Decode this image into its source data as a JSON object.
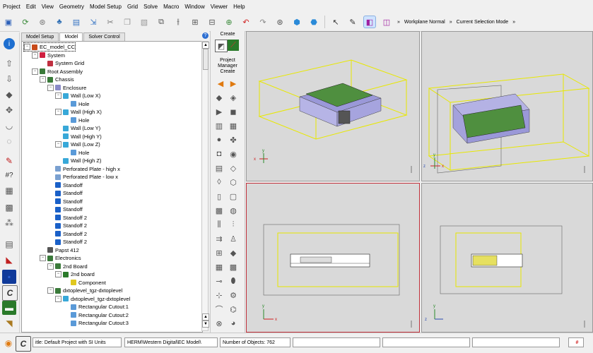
{
  "menu": [
    "Project",
    "Edit",
    "View",
    "Geometry",
    "Model Setup",
    "Grid",
    "Solve",
    "Macro",
    "Window",
    "Viewer",
    "Help"
  ],
  "toolbar": {
    "workplane_label": "Workplane Normal",
    "selection_mode_label": "Current Selection Mode",
    "more_glyph": "»"
  },
  "tabs": [
    "Model Setup",
    "Model",
    "Solver Control"
  ],
  "active_tab": "Model",
  "palette": {
    "title": "Create",
    "manager_label": "Project Manager Create"
  },
  "tree": [
    {
      "label": "EC_model_CC",
      "depth": 0,
      "exp": "-",
      "icon": "root-icon",
      "selected": true
    },
    {
      "label": "System",
      "depth": 1,
      "exp": "-",
      "icon": "system-icon"
    },
    {
      "label": "System Grid",
      "depth": 2,
      "exp": "",
      "icon": "grid-icon"
    },
    {
      "label": "Root Assembly",
      "depth": 1,
      "exp": "-",
      "icon": "assembly-icon"
    },
    {
      "label": "Chassis",
      "depth": 2,
      "exp": "-",
      "icon": "assembly-icon"
    },
    {
      "label": "Enclosure",
      "depth": 3,
      "exp": "-",
      "icon": "enclosure-icon"
    },
    {
      "label": "Wall (Low X)",
      "depth": 4,
      "exp": "-",
      "icon": "wall-icon"
    },
    {
      "label": "Hole",
      "depth": 5,
      "exp": "",
      "icon": "hole-icon"
    },
    {
      "label": "Wall (High X)",
      "depth": 4,
      "exp": "-",
      "icon": "wall-icon"
    },
    {
      "label": "Hole",
      "depth": 5,
      "exp": "",
      "icon": "hole-icon"
    },
    {
      "label": "Wall (Low Y)",
      "depth": 4,
      "exp": "",
      "icon": "wall-icon"
    },
    {
      "label": "Wall (High Y)",
      "depth": 4,
      "exp": "",
      "icon": "wall-icon"
    },
    {
      "label": "Wall (Low Z)",
      "depth": 4,
      "exp": "-",
      "icon": "wall-icon"
    },
    {
      "label": "Hole",
      "depth": 5,
      "exp": "",
      "icon": "hole-icon"
    },
    {
      "label": "Wall (High Z)",
      "depth": 4,
      "exp": "",
      "icon": "wall-icon"
    },
    {
      "label": "Perforated Plate - high x",
      "depth": 3,
      "exp": "",
      "icon": "plate-icon"
    },
    {
      "label": "Perforated Plate - low x",
      "depth": 3,
      "exp": "",
      "icon": "plate-icon"
    },
    {
      "label": "Standoff",
      "depth": 3,
      "exp": "",
      "icon": "standoff-icon"
    },
    {
      "label": "Standoff",
      "depth": 3,
      "exp": "",
      "icon": "standoff-icon"
    },
    {
      "label": "Standoff",
      "depth": 3,
      "exp": "",
      "icon": "standoff-icon"
    },
    {
      "label": "Standoff",
      "depth": 3,
      "exp": "",
      "icon": "standoff-icon"
    },
    {
      "label": "Standoff 2",
      "depth": 3,
      "exp": "",
      "icon": "standoff-icon"
    },
    {
      "label": "Standoff 2",
      "depth": 3,
      "exp": "",
      "icon": "standoff-icon"
    },
    {
      "label": "Standoff 2",
      "depth": 3,
      "exp": "",
      "icon": "standoff-icon"
    },
    {
      "label": "Standoff 2",
      "depth": 3,
      "exp": "",
      "icon": "standoff-icon"
    },
    {
      "label": "Papst 412",
      "depth": 2,
      "exp": "",
      "icon": "fan-icon"
    },
    {
      "label": "Electronics",
      "depth": 2,
      "exp": "-",
      "icon": "assembly-icon"
    },
    {
      "label": "2nd Board",
      "depth": 3,
      "exp": "-",
      "icon": "assembly-icon"
    },
    {
      "label": "2nd board",
      "depth": 4,
      "exp": "-",
      "icon": "pcb-icon"
    },
    {
      "label": "Component",
      "depth": 5,
      "exp": "",
      "icon": "component-icon"
    },
    {
      "label": "dxtoplevel_tgz-dxtoplevel",
      "depth": 3,
      "exp": "-",
      "icon": "assembly-icon"
    },
    {
      "label": "dxtoplevel_tgz-dxtoplevel",
      "depth": 4,
      "exp": "-",
      "icon": "wall-icon"
    },
    {
      "label": "Rectangular Cutout:1",
      "depth": 5,
      "exp": "",
      "icon": "hole-icon"
    },
    {
      "label": "Rectangular Cutout:2",
      "depth": 5,
      "exp": "",
      "icon": "hole-icon"
    },
    {
      "label": "Rectangular Cutout:3",
      "depth": 5,
      "exp": "",
      "icon": "hole-icon"
    }
  ],
  "viewports": {
    "iso_label": "isometric-view",
    "axis_x": "x",
    "axis_y": "y",
    "axis_z": "z"
  },
  "status": {
    "title": "itle: Default Project with SI Units",
    "path": "HERM\\Western Digital\\EC Model\\",
    "objects": "Number of Objects: 762"
  },
  "colors": {
    "selection_box": "#e8e800",
    "pcb": "#4f8f3f",
    "enclosure": "#9a98d8",
    "active_viewport": "#c0303a"
  }
}
